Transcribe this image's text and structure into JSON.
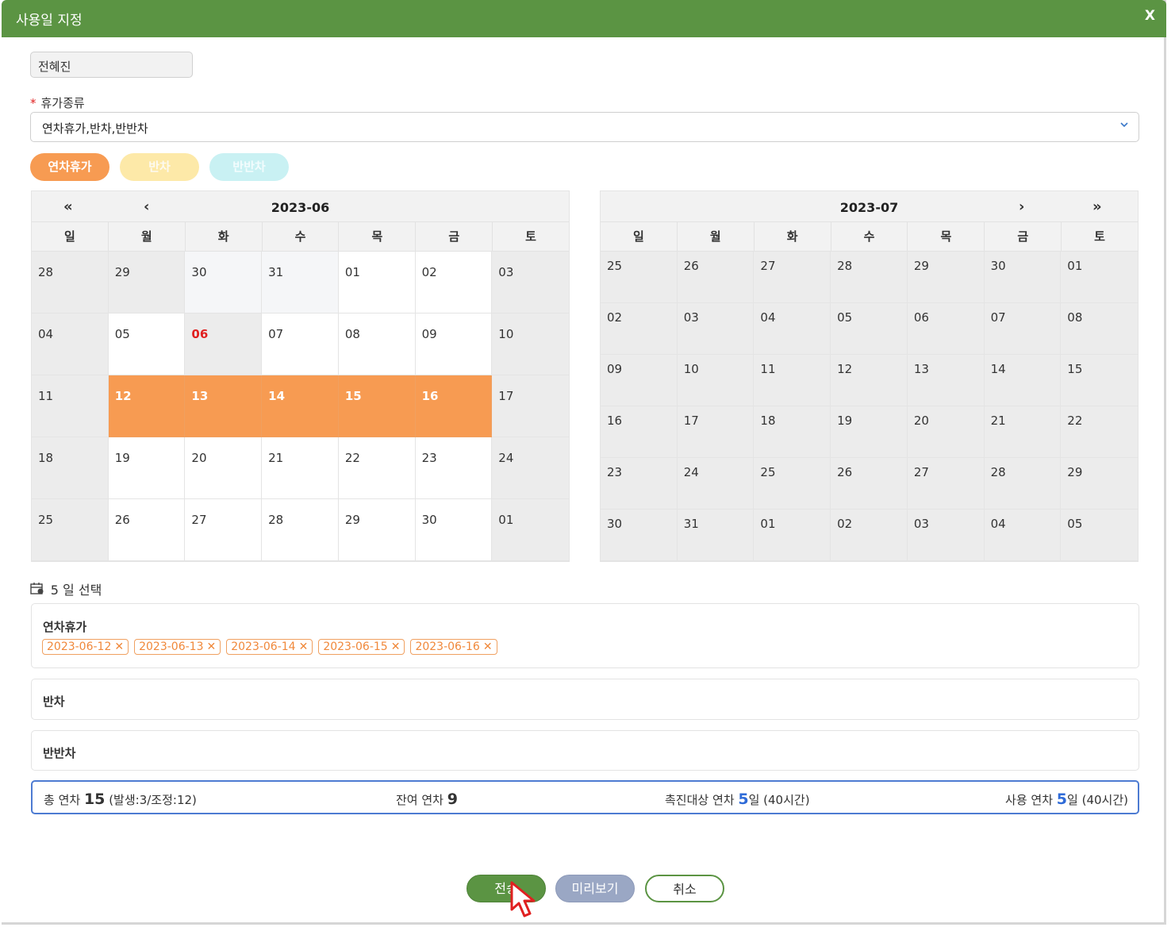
{
  "dialog": {
    "title": "사용일 지정",
    "close_label": "X"
  },
  "employee_name": "전혜진",
  "leave_type": {
    "label": "휴가종류",
    "required_mark": "*",
    "value": "연차휴가,반차,반반차"
  },
  "pills": [
    "연차휴가",
    "반차",
    "반반차"
  ],
  "nav_icons": {
    "prev_year": "«",
    "prev_month": "‹",
    "next_month": "›",
    "next_year": "»"
  },
  "weekdays": [
    "일",
    "월",
    "화",
    "수",
    "목",
    "금",
    "토"
  ],
  "calendar_left": {
    "month": "2023-06",
    "weeks": [
      [
        "28",
        "29",
        "30",
        "31",
        "01",
        "02",
        "03"
      ],
      [
        "04",
        "05",
        "06",
        "07",
        "08",
        "09",
        "10"
      ],
      [
        "11",
        "12",
        "13",
        "14",
        "15",
        "16",
        "17"
      ],
      [
        "18",
        "19",
        "20",
        "21",
        "22",
        "23",
        "24"
      ],
      [
        "25",
        "26",
        "27",
        "28",
        "29",
        "30",
        "01"
      ]
    ]
  },
  "calendar_right": {
    "month": "2023-07",
    "weeks": [
      [
        "25",
        "26",
        "27",
        "28",
        "29",
        "30",
        "01"
      ],
      [
        "02",
        "03",
        "04",
        "05",
        "06",
        "07",
        "08"
      ],
      [
        "09",
        "10",
        "11",
        "12",
        "13",
        "14",
        "15"
      ],
      [
        "16",
        "17",
        "18",
        "19",
        "20",
        "21",
        "22"
      ],
      [
        "23",
        "24",
        "25",
        "26",
        "27",
        "28",
        "29"
      ],
      [
        "30",
        "31",
        "01",
        "02",
        "03",
        "04",
        "05"
      ]
    ]
  },
  "selection": {
    "count_label": "5 일 선택",
    "annual": {
      "title": "연차휴가",
      "dates": [
        "2023-06-12",
        "2023-06-13",
        "2023-06-14",
        "2023-06-15",
        "2023-06-16"
      ]
    },
    "half": {
      "title": "반차"
    },
    "quarter": {
      "title": "반반차"
    }
  },
  "summary": {
    "total_label": "총 연차",
    "total_value": "15",
    "total_detail": "(발생:3/조정:12)",
    "remain_label": "잔여 연차",
    "remain_value": "9",
    "promo_label": "촉진대상 연차",
    "promo_value": "5",
    "promo_suffix": "일 (40시간)",
    "used_label": "사용 연차",
    "used_value": "5",
    "used_suffix": "일 (40시간)"
  },
  "buttons": {
    "submit": "전송",
    "preview": "미리보기",
    "cancel": "취소"
  },
  "colors": {
    "title_bar": "#5b9443",
    "selected": "#f79b52",
    "holiday": "#e02020",
    "summary_border": "#4d7bd2"
  }
}
